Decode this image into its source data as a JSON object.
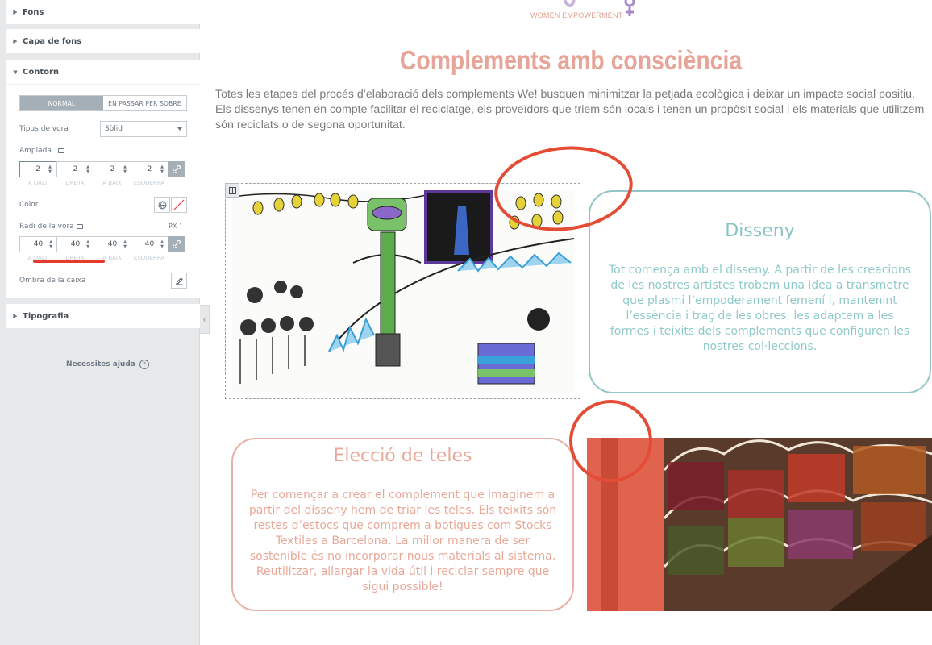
{
  "panel": {
    "sections": {
      "fons": "Fons",
      "capa_fons": "Capa de fons",
      "contorn": "Contorn",
      "tipografia": "Tipografia"
    },
    "tabs": [
      "NORMAL",
      "EN PASSAR PER SOBRE"
    ],
    "border_type_label": "Tipus de vora",
    "border_type_value": "Sòlid",
    "width_label": "Amplada",
    "width_values": [
      "2",
      "2",
      "2",
      "2"
    ],
    "side_labels": [
      "A DALT",
      "DRETA",
      "A BAIX",
      "ESQUERRA"
    ],
    "color_label": "Color",
    "radius_label": "Radi de la vora",
    "radius_unit": "PX",
    "radius_values": [
      "40",
      "40",
      "40",
      "40"
    ],
    "shadow_label": "Ombra de la caixa",
    "help_label": "Necessites ajuda"
  },
  "canvas": {
    "logo_text": "WOMEN EMPOWERMENT",
    "title": "Complements amb consciència",
    "intro_lines": [
      "Totes les etapes del procés d’elaboració dels complements We! busquen minimitzar la petjada ecològica i deixar un impacte social positiu.",
      "Els dissenys tenen en compte facilitar el reciclatge, els proveïdors que triem són locals i tenen un propòsit social i els materials que utilitzem",
      "són reciclats o de segona oportunitat."
    ],
    "disseny": {
      "title": "Disseny",
      "text": "Tot comença amb el disseny. A partir de les creacions de les nostres artistes trobem una idea a transmetre que plasmi l’empoderament femení i, mantenint l’essència i traç de les obres, les adaptem a les formes i teixits dels complements que configuren les nostres col·leccions."
    },
    "teles": {
      "title": "Elecció de teles",
      "text": "Per començar a crear el complement que imaginem a partir del disseny hem de triar les teles. Els teixits són restes d’estocs que comprem a botigues com Stocks Textiles a Barcelona. La millor manera de ser sostenible és no incorporar nous materials al sistema. Reutilitzar, allargar la vida útil i reciclar sempre que sigui possible!"
    }
  },
  "colors": {
    "disseny_accent": "#93c6c8",
    "teles_accent": "#e8b0a4",
    "title_color": "#e6a598",
    "annotation_red": "#e44c36"
  }
}
